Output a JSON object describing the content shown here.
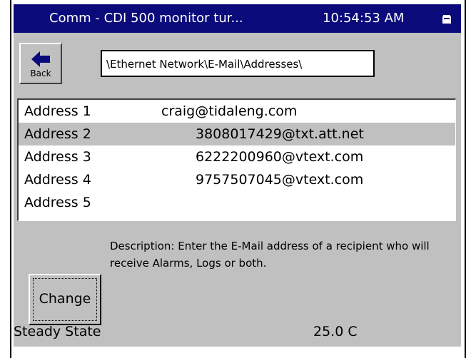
{
  "titlebar": {
    "title": "Comm - CDI 500 monitor tur...",
    "clock": "10:54:53 AM",
    "background": "#0a0a7a"
  },
  "toolbar": {
    "back_label": "Back",
    "back_icon": "arrow-left-icon",
    "path": "\\Ethernet Network\\E-Mail\\Addresses\\"
  },
  "addresses": [
    {
      "name": "Address 1",
      "value": "craig@tidaleng.com"
    },
    {
      "name": "Address 2",
      "value": "3808017429@txt.att.net",
      "selected": true
    },
    {
      "name": "Address 3",
      "value": "6222200960@vtext.com"
    },
    {
      "name": "Address 4",
      "value": "9757507045@vtext.com"
    },
    {
      "name": "Address 5",
      "value": ""
    }
  ],
  "description": "Description:  Enter the E-Mail address of a recipient who will receive Alarms, Logs or both.",
  "change_label": "Change",
  "status": {
    "state": "Steady State",
    "temperature": "25.0 C"
  },
  "colors": {
    "panel": "#c0c0c0",
    "selected_row": "#c0c0c0",
    "title_text": "#ffffff"
  }
}
